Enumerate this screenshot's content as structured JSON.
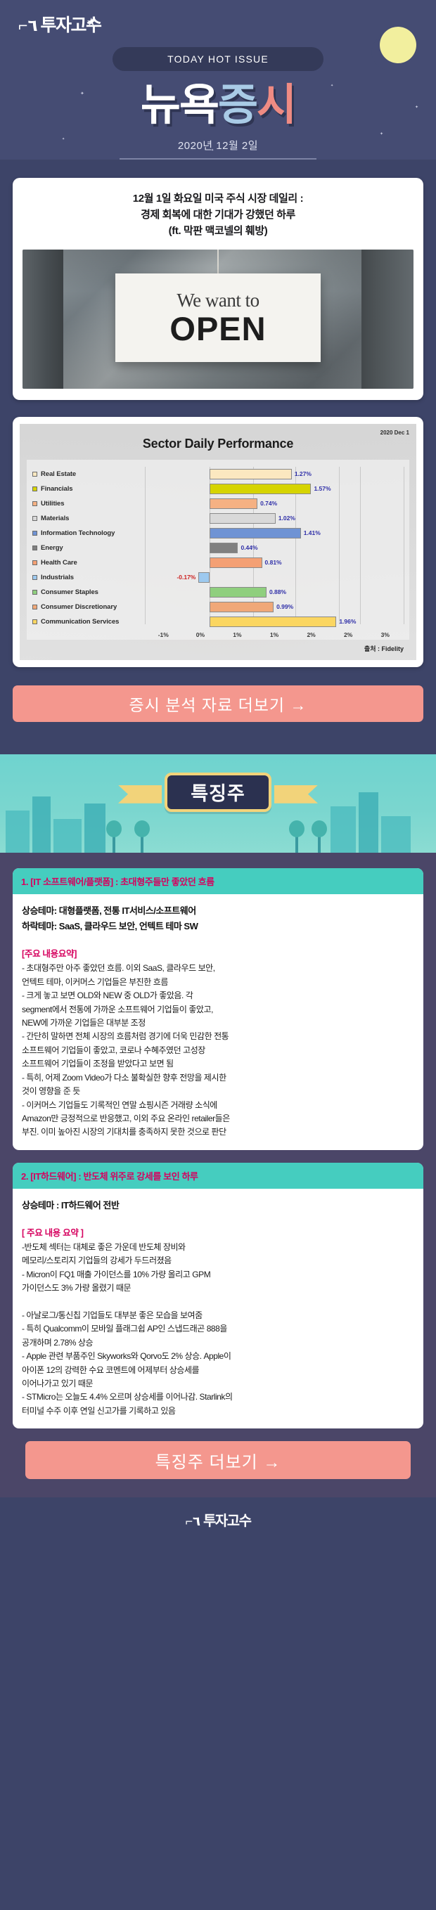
{
  "brand": {
    "mark": "⌐٦",
    "name": "투자고수"
  },
  "hero": {
    "hot_label": "TODAY HOT ISSUE",
    "title_part1": "뉴욕",
    "title_part2": "증",
    "title_part3": "시",
    "date": "2020년 12월 2일",
    "moon_icon": "crescent-moon-icon",
    "star_icon": "star-icon"
  },
  "article": {
    "title_line1": "12월 1일 화요일 미국 주식 시장 데일리 :",
    "title_line2": "경제 회복에 대한 기대가 강했던 하루",
    "title_line3": "(ft. 막판 맥코넬의 훼방)",
    "photo_sign_line1": "We want to",
    "photo_sign_line2": "OPEN"
  },
  "chart_data": {
    "type": "bar",
    "title": "Sector Daily Performance",
    "date_label": "2020 Dec 1",
    "source": "출처 : Fidelity",
    "orientation": "horizontal",
    "xlabel": "",
    "ylabel": "",
    "xlim": [
      -1,
      3
    ],
    "grid": true,
    "tick_labels": [
      "-1%",
      "0%",
      "1%",
      "1%",
      "2%",
      "2%",
      "3%"
    ],
    "tick_values": [
      -1,
      0,
      0.67,
      1.33,
      2,
      2.33,
      3
    ],
    "legend_position": "left",
    "categories": [
      "Real Estate",
      "Financials",
      "Utilities",
      "Materials",
      "Information Technology",
      "Energy",
      "Health Care",
      "Industrials",
      "Consumer Staples",
      "Consumer Discretionary",
      "Communication Services"
    ],
    "values": [
      1.27,
      1.57,
      0.74,
      1.02,
      1.41,
      0.44,
      0.81,
      -0.17,
      0.88,
      0.99,
      1.96
    ],
    "value_labels": [
      "1.27%",
      "1.57%",
      "0.74%",
      "1.02%",
      "1.41%",
      "0.44%",
      "0.81%",
      "-0.17%",
      "0.88%",
      "0.99%",
      "1.96%"
    ],
    "colors": [
      "#fbe8c0",
      "#d6d400",
      "#f5b183",
      "#d9d9d9",
      "#6f93d4",
      "#808080",
      "#f4a074",
      "#9dc9ef",
      "#8fcf7e",
      "#f0a878",
      "#fbd661"
    ]
  },
  "cta_primary": {
    "label": "증시 분석 자료 더보기 →"
  },
  "banner": {
    "label": "특징주"
  },
  "sections": [
    {
      "heading": "1. [IT 소프트웨어/플랫폼] : 초대형주들만 좋았던 흐름",
      "theme_up": "상승테마: 대형플랫폼, 전통 IT서비스/소프트웨어",
      "theme_down": "하락테마: SaaS, 클라우드 보안, 언텍트 테마 SW",
      "summary_head": "[주요 내용요약]",
      "summary_body": "- 초대형주만 아주 좋았던 흐름. 이외 SaaS, 클라우드 보안,\n언텍트 테마, 이커머스 기업들은 부진한 흐름\n- 크게 놓고 보면 OLD와 NEW 중 OLD가 좋았음. 각\nsegment에서 전통에 가까운 소프트웨어 기업들이 좋았고,\nNEW에 가까운 기업들은 대부분 조정\n- 간단히 말하면 전체 시장의 흐름처럼 경기에 더욱 민감한 전통\n소프트웨어 기업들이 좋았고, 코로나 수혜주였던 고성장\n소프트웨어 기업들이 조정을 받았다고 보면 됨\n- 특히, 어제 Zoom Video가 다소 불확실한 향후 전망을 제시한\n것이 영향을 준 듯\n- 이커머스 기업들도 기록적인 연말 쇼핑시즌 거래량 소식에\nAmazon만 긍정적으로 반응했고, 이외 주요 온라인 retailer들은\n부진. 이미 높아진 시장의 기대치를 충족하지 못한 것으로 판단"
    },
    {
      "heading": "2. [IT하드웨어] : 반도체 위주로 강세를 보인 하루",
      "theme_up": "상승테마 : IT하드웨어 전반",
      "theme_down": "",
      "summary_head": "[ 주요 내용 요약 ]",
      "summary_body": "-반도체 섹터는 대체로 좋은 가운데 반도체 장비와\n메모리/스토리지 기업들의 강세가 두드러졌음\n- Micron이 FQ1 매출 가이던스를 10% 가량 올리고 GPM\n가이던스도 3% 가량 올렸기 때문\n\n- 아날로그/통신칩 기업들도 대부분 좋은 모습을 보여줌\n- 특히 Qualcomm이 모바일 플래그쉽 AP인 스냅드래곤 888을\n공개하며 2.78% 상승\n- Apple 관련 부품주인 Skyworks와 Qorvo도 2% 상승. Apple이\n아이폰 12의 강력한 수요 코멘트에 어제부터 상승세를\n이어나가고 있기 때문\n- STMicro는 오늘도 4.4% 오르며 상승세를 이어나감. Starlink의\n터미널 수주 이후 연일 신고가를 기록하고 있음"
    }
  ],
  "cta_secondary": {
    "label": "특징주 더보기 →"
  }
}
